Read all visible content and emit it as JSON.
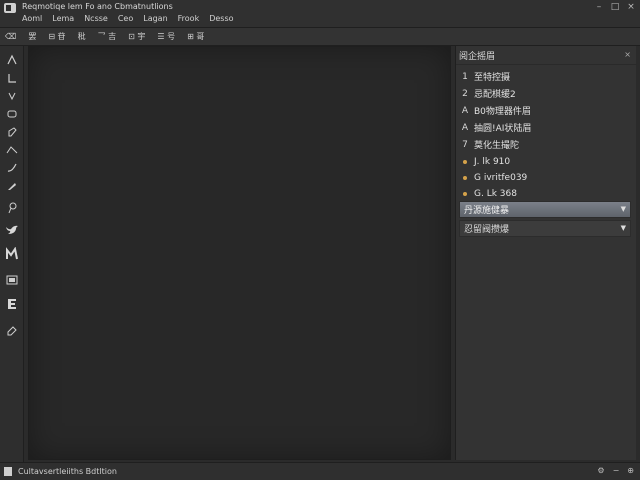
{
  "app": {
    "title": "Reqmotiqe  lem  Fo  ano  Cbmatnutlions"
  },
  "window_controls": [
    "–",
    "□",
    "×"
  ],
  "menu": [
    "Aoml",
    "Lema",
    "Ncsse",
    "Ceo",
    "Lagan",
    "Frook",
    "Desso"
  ],
  "toolbar": {
    "buttons": [
      {
        "icon": "undo-icon",
        "label": "⌫"
      },
      {
        "icon": "dashes-icon",
        "label": "罢"
      },
      {
        "icon": "frame-icon",
        "label": "⊟ 苷"
      },
      {
        "icon": "pen-icon",
        "label": "秕"
      },
      {
        "icon": "slash-icon",
        "label": "乛 吉"
      },
      {
        "icon": "grid-icon",
        "label": "⊡ 宇"
      },
      {
        "icon": "list-icon",
        "label": "☰ 号"
      },
      {
        "icon": "layers-icon",
        "label": "⊞ 哥"
      }
    ]
  },
  "tools": [
    "pen-tool-icon",
    "angle-tool-icon",
    "hook-tool-icon",
    "eraser-tool-icon",
    "brush-tool-icon",
    "shape-tool-icon",
    "line-tool-icon",
    "quill-tool-icon",
    "pin-tool-icon",
    "bird-tool-icon",
    "pattern-tool-icon",
    "keyboard-tool-icon",
    "stamp-tool-icon",
    "erase-tool-icon"
  ],
  "panel": {
    "title": "阅企摇眉",
    "close": "×",
    "items": [
      {
        "marker": "1",
        "label": "至特控摄"
      },
      {
        "marker": "2",
        "label": "忌配棋缓2"
      },
      {
        "marker": "A",
        "label": "B0物理器件眉"
      },
      {
        "marker": "A",
        "label": "抽圆!AI状陆眉"
      },
      {
        "marker": "7",
        "label": "莫化生撮陀"
      }
    ],
    "values": [
      {
        "label": "J. lk 910"
      },
      {
        "label": "G ivritfe039"
      },
      {
        "label": "G. Lk 368"
      }
    ],
    "dropdowns": [
      {
        "label": "丹源施健暴",
        "state": "active"
      },
      {
        "label": "忍留阀攒爆",
        "state": "inactive"
      }
    ],
    "accent_color": "#d5a24a"
  },
  "status": {
    "text": "Cultavsertleiiths Bdtltion"
  }
}
